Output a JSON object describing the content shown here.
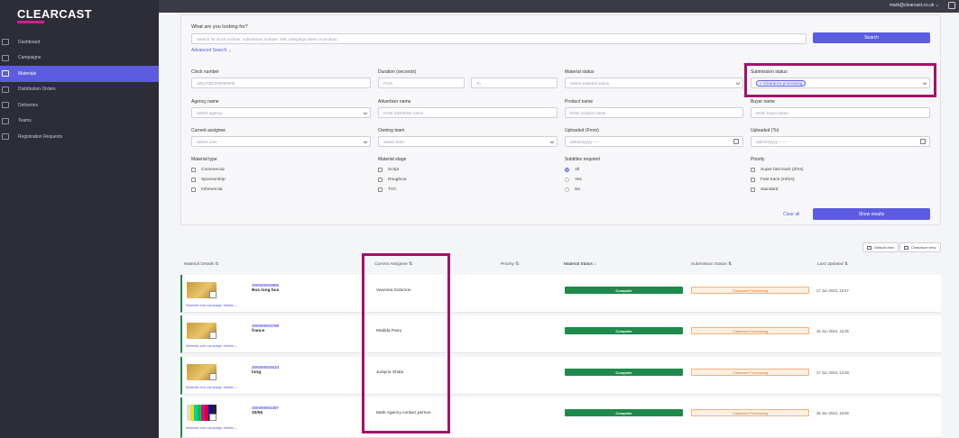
{
  "brand": "CLEARCAST",
  "user": "mark@clearcast.co.uk",
  "nav": [
    {
      "label": "Dashboard",
      "icon": "dashboard-icon",
      "active": false
    },
    {
      "label": "Campaigns",
      "icon": "campaigns-icon",
      "active": false
    },
    {
      "label": "Materials",
      "icon": "materials-icon",
      "active": true
    },
    {
      "label": "Distribution Orders",
      "icon": "distribution-icon",
      "active": false
    },
    {
      "label": "Deliveries",
      "icon": "deliveries-icon",
      "active": false
    },
    {
      "label": "Teams",
      "icon": "teams-icon",
      "active": false
    },
    {
      "label": "Registration Requests",
      "icon": "registration-icon",
      "active": false
    }
  ],
  "search": {
    "question": "What are you looking for?",
    "placeholder": "Search for clock number, submission number, title, campaign name or product...",
    "button": "Search",
    "advanced": "Advanced Search"
  },
  "filters": {
    "clock_number": {
      "label": "Clock number",
      "placeholder": "ABC/ABC000000000"
    },
    "duration": {
      "label": "Duration (seconds)",
      "from": "From",
      "to": "To"
    },
    "material_status": {
      "label": "Material status",
      "placeholder": "Select material status"
    },
    "submission_status": {
      "label": "Submission status",
      "chip": "Clearance processing"
    },
    "agency_name": {
      "label": "Agency name",
      "placeholder": "Select agency"
    },
    "advertiser_name": {
      "label": "Advertiser name",
      "placeholder": "Enter advertiser name"
    },
    "product_name": {
      "label": "Product name",
      "placeholder": "Enter product name"
    },
    "buyer_name": {
      "label": "Buyer name",
      "placeholder": "Enter buyer name"
    },
    "current_assignee": {
      "label": "Current assignee",
      "placeholder": "Select user"
    },
    "owning_team": {
      "label": "Owning team",
      "placeholder": "Select team"
    },
    "uploaded_from": {
      "label": "Uploaded (From)",
      "placeholder": "dd/mm/yyyy --:--"
    },
    "uploaded_to": {
      "label": "Uploaded (To)",
      "placeholder": "dd/mm/yyyy --:--"
    },
    "material_type": {
      "label": "Material type",
      "options": [
        "Commercial",
        "Sponsorship",
        "Infomercial"
      ]
    },
    "material_stage": {
      "label": "Material stage",
      "options": [
        "Script",
        "Roughcut",
        "TVC"
      ]
    },
    "subtitles": {
      "label": "Subtitles required",
      "options": [
        "All",
        "Yes",
        "No"
      ],
      "selected": "All"
    },
    "priority": {
      "label": "Priority",
      "options": [
        "Super fast track (2hrs)",
        "Fast track (24hrs)",
        "Standard"
      ]
    },
    "clear_all": "Clear all",
    "show_results": "Show results"
  },
  "views": {
    "default": "Default view",
    "clearance": "Clearance view"
  },
  "table": {
    "headers": {
      "material_details": "Material Details ⇅",
      "current_assignee": "Current Assignee ⇅",
      "priority": "Priority ⇅",
      "material_status": "Material Status ↓",
      "submission_status": "Submission Status ⇅",
      "last_updated": "Last Updated ⇅"
    },
    "rows": [
      {
        "clock": "300000003855",
        "title": "Bus long bus",
        "link": "Material and campaign details ⌄",
        "assignee": "Vanessa Solomon",
        "status": "Complete",
        "submission": "Clearance Processing",
        "updated": "27 Jun 2024, 15:57",
        "thumb": "gold"
      },
      {
        "clock": "300000003798",
        "title": "france",
        "link": "Material and campaign details ⌄",
        "assignee": "Matilda Parry",
        "status": "Complete",
        "submission": "Clearance Processing",
        "updated": "26 Jun 2024, 16:05",
        "thumb": "gold"
      },
      {
        "clock": "300000003533",
        "title": "long",
        "link": "Material and campaign details ⌄",
        "assignee": "Justyna Shala",
        "status": "Complete",
        "submission": "Clearance Processing",
        "updated": "27 Jun 2024, 14:48",
        "thumb": "gold"
      },
      {
        "clock": "300000003387",
        "title": "10/06",
        "link": "Material and campaign details ⌄",
        "assignee": "Mark Agency contact person",
        "status": "Complete",
        "submission": "Clearance Processing",
        "updated": "25 Jun 2024, 16:56",
        "thumb": "bars"
      }
    ]
  },
  "colors": {
    "accent": "#5c5ce0",
    "highlight": "#a4106d",
    "complete": "#1e8a4c",
    "sidebar": "#2c2d36"
  }
}
